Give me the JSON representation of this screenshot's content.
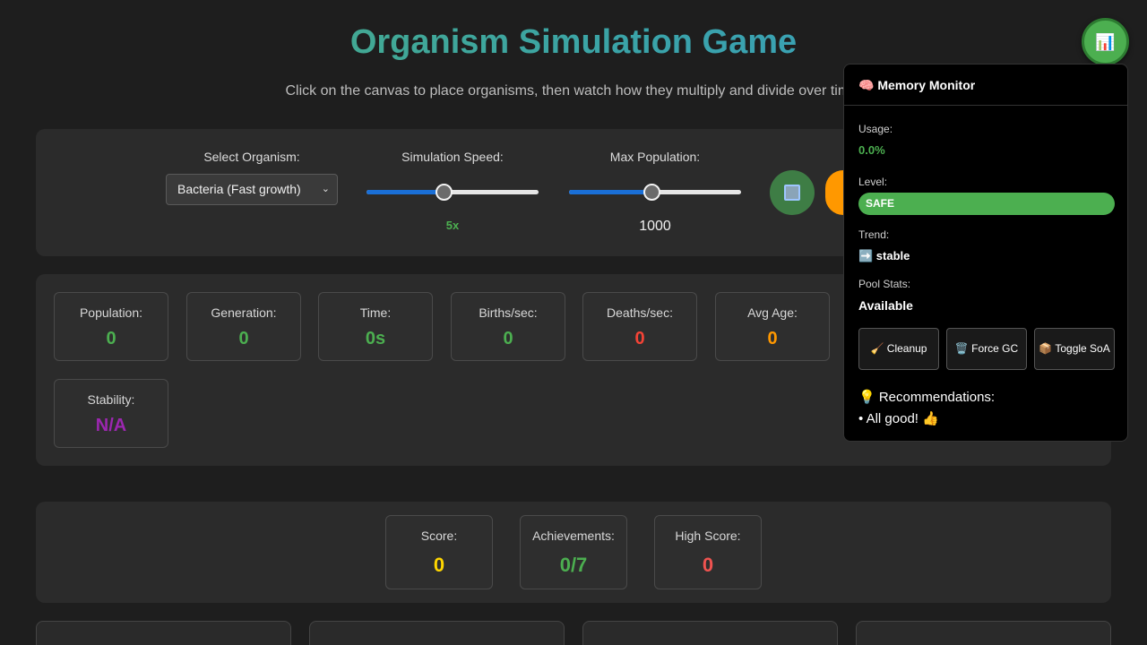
{
  "header": {
    "title": "Organism Simulation Game",
    "subtitle": "Click on the canvas to place organisms, then watch how they multiply and divide over time."
  },
  "controls": {
    "organism_label": "Select Organism:",
    "organism_value": "Bacteria (Fast growth)",
    "speed_label": "Simulation Speed:",
    "speed_value": "5x",
    "speed_fraction": 0.45,
    "max_pop_label": "Max Population:",
    "max_pop_value": "1000",
    "max_pop_fraction": 0.48
  },
  "stats": [
    {
      "label": "Population:",
      "value": "0",
      "color": "#4caf50"
    },
    {
      "label": "Generation:",
      "value": "0",
      "color": "#4caf50"
    },
    {
      "label": "Time:",
      "value": "0s",
      "color": "#4caf50"
    },
    {
      "label": "Births/sec:",
      "value": "0",
      "color": "#4caf50"
    },
    {
      "label": "Deaths/sec:",
      "value": "0",
      "color": "#f44336"
    },
    {
      "label": "Avg Age:",
      "value": "0",
      "color": "#ff9800"
    },
    {
      "label": "Stability:",
      "value": "N/A",
      "color": "#9c27b0"
    }
  ],
  "scores": [
    {
      "label": "Score:",
      "value": "0",
      "color": "#ffd600"
    },
    {
      "label": "Achievements:",
      "value": "0/7",
      "color": "#4caf50"
    },
    {
      "label": "High Score:",
      "value": "0",
      "color": "#ef5350"
    }
  ],
  "monitor": {
    "toggle_icon": "📊",
    "title": "🧠 Memory Monitor",
    "usage_label": "Usage:",
    "usage_value": "0.0%",
    "level_label": "Level:",
    "level_value": "SAFE",
    "trend_label": "Trend:",
    "trend_value": "➡️ stable",
    "pool_label": "Pool Stats:",
    "pool_value": "Available",
    "cleanup_label": "🧹 Cleanup",
    "gc_label": "🗑️ Force GC",
    "soa_label": "📦 Toggle SoA",
    "rec_title": "💡 Recommendations:",
    "rec_item": "• All good! 👍"
  },
  "colors": {
    "accent_green": "#4caf50",
    "accent_orange": "#ff9800",
    "accent_blue": "#1a6fd6"
  }
}
